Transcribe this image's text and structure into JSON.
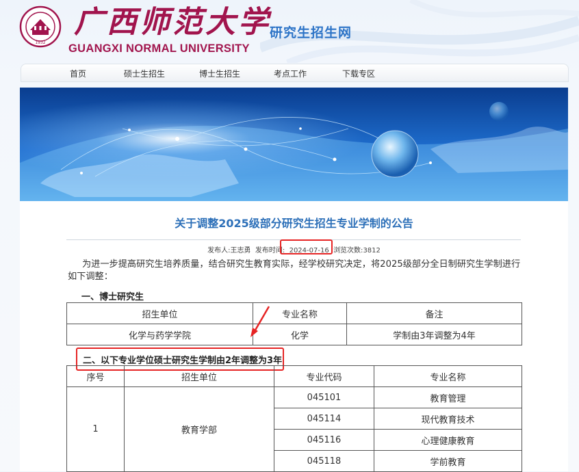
{
  "header": {
    "cn_name": "广西师范大学",
    "en_name": "GUANGXI NORMAL UNIVERSITY",
    "site_name": "研究生招生网",
    "seal_year": "1932"
  },
  "nav": {
    "items": [
      "首页",
      "硕士生招生",
      "博士生招生",
      "考点工作",
      "下载专区"
    ]
  },
  "article": {
    "title": "关于调整2025级部分研究生招生专业学制的公告",
    "meta": {
      "publisher_label": "发布人:",
      "publisher": "王志勇",
      "time_label": "发布时间:",
      "date": "2024-07-16",
      "views_label": "浏览次数:",
      "views": "3812"
    },
    "intro": "为进一步提高研究生培养质量，结合研究生教育实际，经学校研究决定，将2025级部分全日制研究生学制进行如下调整：",
    "section1": "一、博士研究生",
    "table1": {
      "headers": [
        "招生单位",
        "专业名称",
        "备注"
      ],
      "row": [
        "化学与药学学院",
        "化学",
        "学制由3年调整为4年"
      ]
    },
    "section2": "二、以下专业学位硕士研究生学制由2年调整为3年",
    "table2": {
      "headers": [
        "序号",
        "招生单位",
        "专业代码",
        "专业名称"
      ],
      "group": {
        "seq": "1",
        "unit": "教育学部"
      },
      "rows": [
        {
          "code": "045101",
          "name": "教育管理"
        },
        {
          "code": "045114",
          "name": "现代教育技术"
        },
        {
          "code": "045116",
          "name": "心理健康教育"
        },
        {
          "code": "045118",
          "name": "学前教育"
        }
      ]
    }
  },
  "colors": {
    "brand": "#a1144d",
    "site_blue": "#2d74c7",
    "title_blue": "#2c6fb8",
    "highlight_red": "#e62424"
  }
}
